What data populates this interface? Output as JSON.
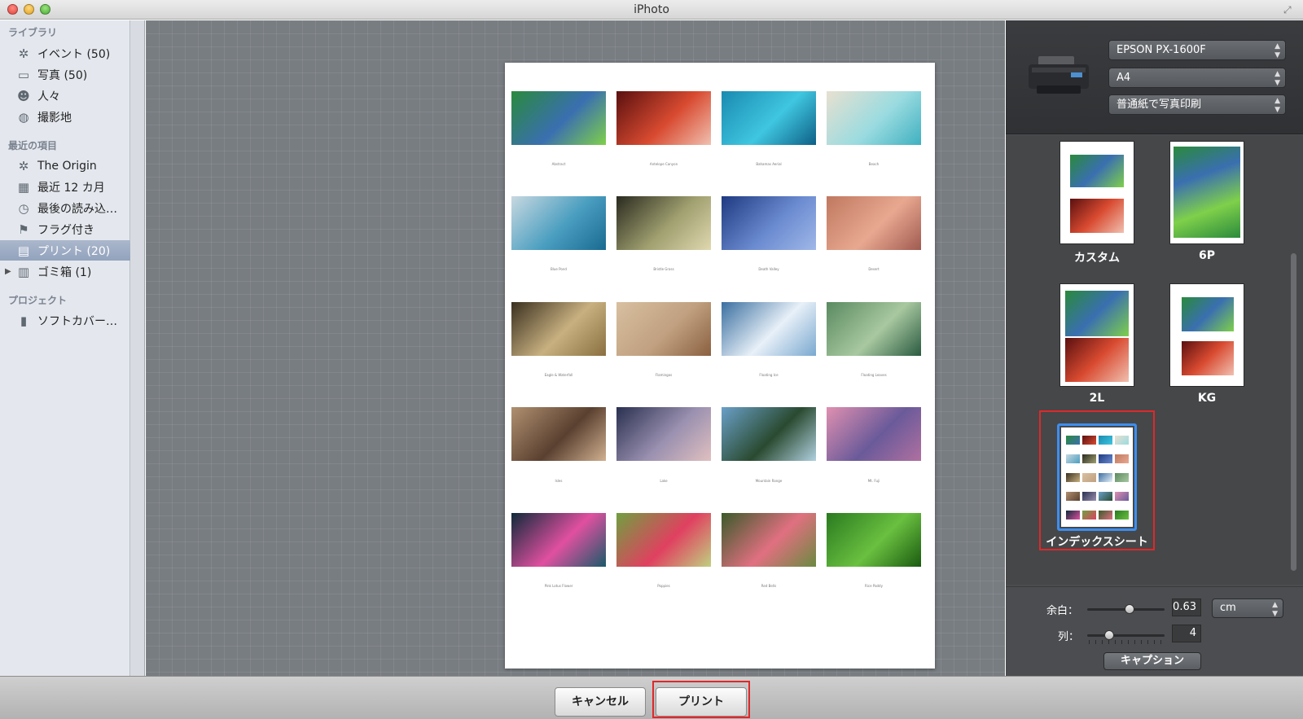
{
  "window": {
    "title": "iPhoto"
  },
  "sidebar": {
    "sections": [
      {
        "heading": "ライブラリ",
        "items": [
          {
            "label": "イベント (50)",
            "icon": "palm-icon"
          },
          {
            "label": "写真 (50)",
            "icon": "photo-icon"
          },
          {
            "label": "人々",
            "icon": "person-icon"
          },
          {
            "label": "撮影地",
            "icon": "globe-icon"
          }
        ]
      },
      {
        "heading": "最近の項目",
        "items": [
          {
            "label": "The Origin",
            "icon": "palm-icon"
          },
          {
            "label": "最近 12 カ月",
            "icon": "calendar-icon"
          },
          {
            "label": "最後の読み込…",
            "icon": "clock-icon"
          },
          {
            "label": "フラグ付き",
            "icon": "flag-icon"
          },
          {
            "label": "プリント (20)",
            "icon": "printer-icon",
            "selected": true
          },
          {
            "label": "ゴミ箱 (1)",
            "icon": "trash-icon"
          }
        ]
      },
      {
        "heading": "プロジェクト",
        "items": [
          {
            "label": "ソフトカバー…",
            "icon": "book-icon"
          }
        ]
      }
    ]
  },
  "page": {
    "photos": [
      {
        "caption": "Abstract",
        "colors": [
          "#2a8a3c",
          "#3a6fb0",
          "#7fd04a"
        ]
      },
      {
        "caption": "Antelope Canyon",
        "colors": [
          "#5a1010",
          "#d84a30",
          "#f0c0b0"
        ]
      },
      {
        "caption": "Bahamas Aerial",
        "colors": [
          "#1a8ab0",
          "#3fc6e0",
          "#0e5f86"
        ]
      },
      {
        "caption": "Beach",
        "colors": [
          "#e8e0d0",
          "#9adbe0",
          "#3fb0c0"
        ]
      },
      {
        "caption": "Blue Pond",
        "colors": [
          "#c8d8e0",
          "#4a9ec0",
          "#1a6a90"
        ]
      },
      {
        "caption": "Bristle Grass",
        "colors": [
          "#2a2a20",
          "#a0a070",
          "#e0d8b0"
        ]
      },
      {
        "caption": "Death Valley",
        "colors": [
          "#1e3a80",
          "#6a8ad0",
          "#a0b8e8"
        ]
      },
      {
        "caption": "Desert",
        "colors": [
          "#c07860",
          "#e8a890",
          "#a05a50"
        ]
      },
      {
        "caption": "Eagle & Waterfall",
        "colors": [
          "#3a3020",
          "#c8b080",
          "#8a7040"
        ]
      },
      {
        "caption": "Flamingos",
        "colors": [
          "#d8c0a0",
          "#c0a080",
          "#8a6040"
        ]
      },
      {
        "caption": "Floating Ice",
        "colors": [
          "#3a6fa0",
          "#e8f0f8",
          "#7aa8d0"
        ]
      },
      {
        "caption": "Floating Leaves",
        "colors": [
          "#5a8a60",
          "#a8c8a0",
          "#2a5a40"
        ]
      },
      {
        "caption": "Isles",
        "colors": [
          "#b09070",
          "#5a4030",
          "#d0b090"
        ]
      },
      {
        "caption": "Lake",
        "colors": [
          "#2a3050",
          "#9a90b0",
          "#e0c0c0"
        ]
      },
      {
        "caption": "Mountain Range",
        "colors": [
          "#6aa0c8",
          "#2a4a30",
          "#b0d0e0"
        ]
      },
      {
        "caption": "Mt. Fuji",
        "colors": [
          "#e090b0",
          "#6a5a9a",
          "#b070a0"
        ]
      },
      {
        "caption": "Pink Lotus Flower",
        "colors": [
          "#0e2a3a",
          "#e050a0",
          "#1a5a6a"
        ]
      },
      {
        "caption": "Poppies",
        "colors": [
          "#70a040",
          "#e04060",
          "#c0d080"
        ]
      },
      {
        "caption": "Red Bells",
        "colors": [
          "#3a5a2a",
          "#e07080",
          "#6a8a40"
        ]
      },
      {
        "caption": "Rice Paddy",
        "colors": [
          "#2a7a20",
          "#6ac040",
          "#1a5a10"
        ]
      }
    ]
  },
  "printer": {
    "printer_name": "EPSON PX-1600F",
    "paper_size": "A4",
    "print_mode": "普通紙で写真印刷"
  },
  "themes": [
    {
      "label": "カスタム"
    },
    {
      "label": "6P"
    },
    {
      "label": "2L"
    },
    {
      "label": "KG"
    },
    {
      "label": "インデックスシート",
      "selected": true
    }
  ],
  "controls": {
    "margin_label": "余白：",
    "margin_value": "0.63",
    "margin_unit": "cm",
    "margin_slider_fraction": 0.55,
    "columns_label": "列：",
    "columns_value": "4",
    "columns_slider_fraction": 0.28,
    "caption_button": "キャプション"
  },
  "buttons": {
    "cancel": "キャンセル",
    "print": "プリント"
  },
  "colors": {
    "highlight": "#e0282a",
    "selection": "#3d8ef0"
  }
}
